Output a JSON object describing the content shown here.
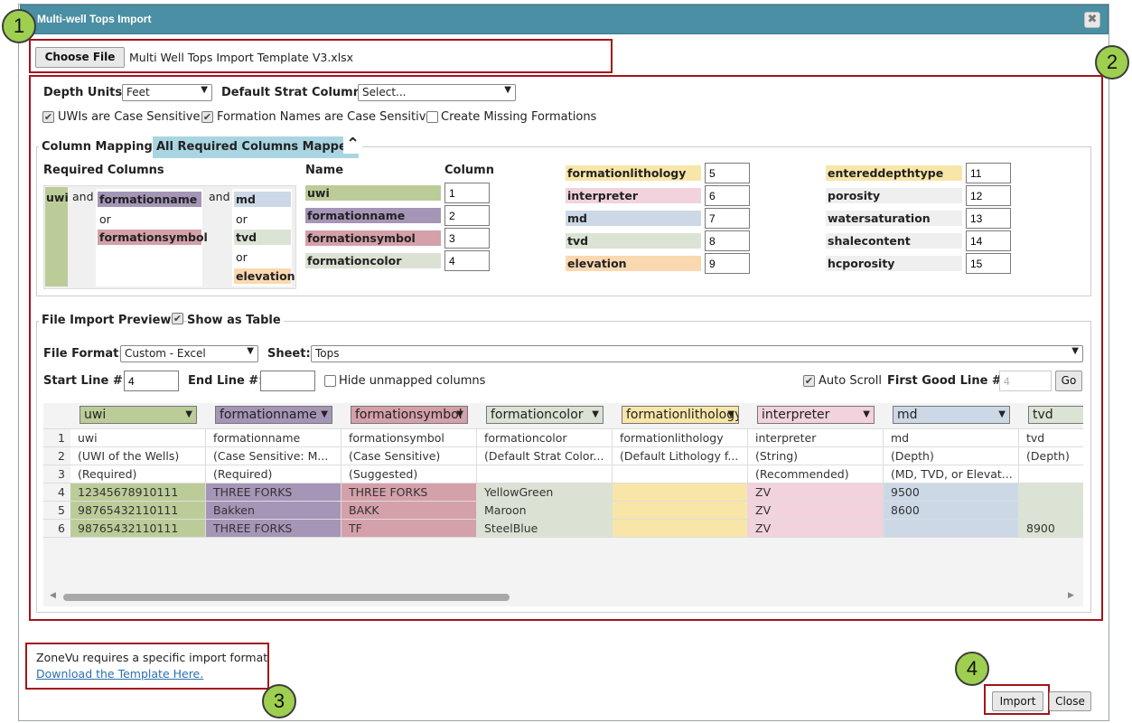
{
  "dialog": {
    "title": "Multi-well Tops Import",
    "close_glyph": "✖"
  },
  "file": {
    "choose_label": "Choose File",
    "file_name": "Multi Well Tops Import Template V3.xlsx"
  },
  "badges": [
    "1",
    "2",
    "3",
    "4"
  ],
  "options": {
    "depth_units_label": "Depth Units:",
    "depth_units_value": "Feet",
    "strat_label": "Default Strat Column:",
    "strat_value": "Select...",
    "uwi_case_label": "UWIs are Case Sensitive",
    "uwi_case_checked": true,
    "formation_case_label": "Formation Names are Case Sensitive",
    "formation_case_checked": true,
    "create_missing_label": "Create Missing Formations",
    "create_missing_checked": false
  },
  "mappings": {
    "legend": "Column Mappings",
    "status": "All Required Columns Mapped",
    "collapse_glyph": "⌃",
    "required_title": "Required Columns",
    "req_uwi": "uwi",
    "req_and1": "and",
    "req_fname": "formationname",
    "req_or1": "or",
    "req_fsym": "formationsymbol",
    "req_and2": "and",
    "req_md": "md",
    "req_or2": "or",
    "req_tvd": "tvd",
    "req_or3": "or",
    "req_elev": "elevation",
    "name_header": "Name",
    "column_header": "Column",
    "fields": [
      {
        "name": "uwi",
        "col": "1"
      },
      {
        "name": "formationname",
        "col": "2"
      },
      {
        "name": "formationsymbol",
        "col": "3"
      },
      {
        "name": "formationcolor",
        "col": "4"
      },
      {
        "name": "formationlithology",
        "col": "5"
      },
      {
        "name": "interpreter",
        "col": "6"
      },
      {
        "name": "md",
        "col": "7"
      },
      {
        "name": "tvd",
        "col": "8"
      },
      {
        "name": "elevation",
        "col": "9"
      },
      {
        "name": "entereddepthtype",
        "col": "11"
      },
      {
        "name": "porosity",
        "col": "12"
      },
      {
        "name": "watersaturation",
        "col": "13"
      },
      {
        "name": "shalecontent",
        "col": "14"
      },
      {
        "name": "hcporosity",
        "col": "15"
      }
    ]
  },
  "preview": {
    "legend": "File Import Preview",
    "show_table_label": "Show as Table",
    "show_table_checked": true,
    "format_label": "File Format:",
    "format_value": "Custom - Excel",
    "sheet_label": "Sheet:",
    "sheet_value": "Tops",
    "start_label": "Start Line #:",
    "start_value": "4",
    "end_label": "End Line #:",
    "end_value": "",
    "hide_unmapped_label": "Hide unmapped columns",
    "hide_unmapped_checked": false,
    "auto_scroll_label": "Auto Scroll",
    "auto_scroll_checked": true,
    "first_good_label": "First Good Line #:",
    "first_good_value": "4",
    "go_label": "Go",
    "column_selects": [
      "uwi",
      "formationname",
      "formationsymbol",
      "formationcolor",
      "formationlithology",
      "interpreter",
      "md",
      "tvd"
    ],
    "row_numbers": [
      "1",
      "2",
      "3",
      "4",
      "5",
      "6"
    ],
    "rows": [
      [
        "uwi",
        "formationname",
        "formationsymbol",
        "formationcolor",
        "formationlithology",
        "interpreter",
        "md",
        "tvd"
      ],
      [
        "(UWI of the Wells)",
        "(Case Sensitive: M...",
        "(Case Sensitive)",
        "(Default Strat Color...",
        "(Default Lithology f...",
        "(String)",
        "(Depth)",
        "(Depth)"
      ],
      [
        "(Required)",
        "(Required)",
        "(Suggested)",
        "",
        "",
        "(Recommended)",
        "(MD, TVD, or Elevat...",
        ""
      ],
      [
        "12345678910111",
        "THREE FORKS",
        "THREE FORKS",
        "YellowGreen",
        "",
        "ZV",
        "9500",
        ""
      ],
      [
        "98765432110111",
        "Bakken",
        "BAKK",
        "Maroon",
        "",
        "ZV",
        "8600",
        ""
      ],
      [
        "98765432110111",
        "THREE FORKS",
        "TF",
        "SteelBlue",
        "",
        "ZV",
        "",
        "8900"
      ]
    ]
  },
  "footer": {
    "note": "ZoneVu requires a specific import format",
    "link": "Download the Template Here.",
    "import_label": "Import",
    "close_label": "Close"
  }
}
